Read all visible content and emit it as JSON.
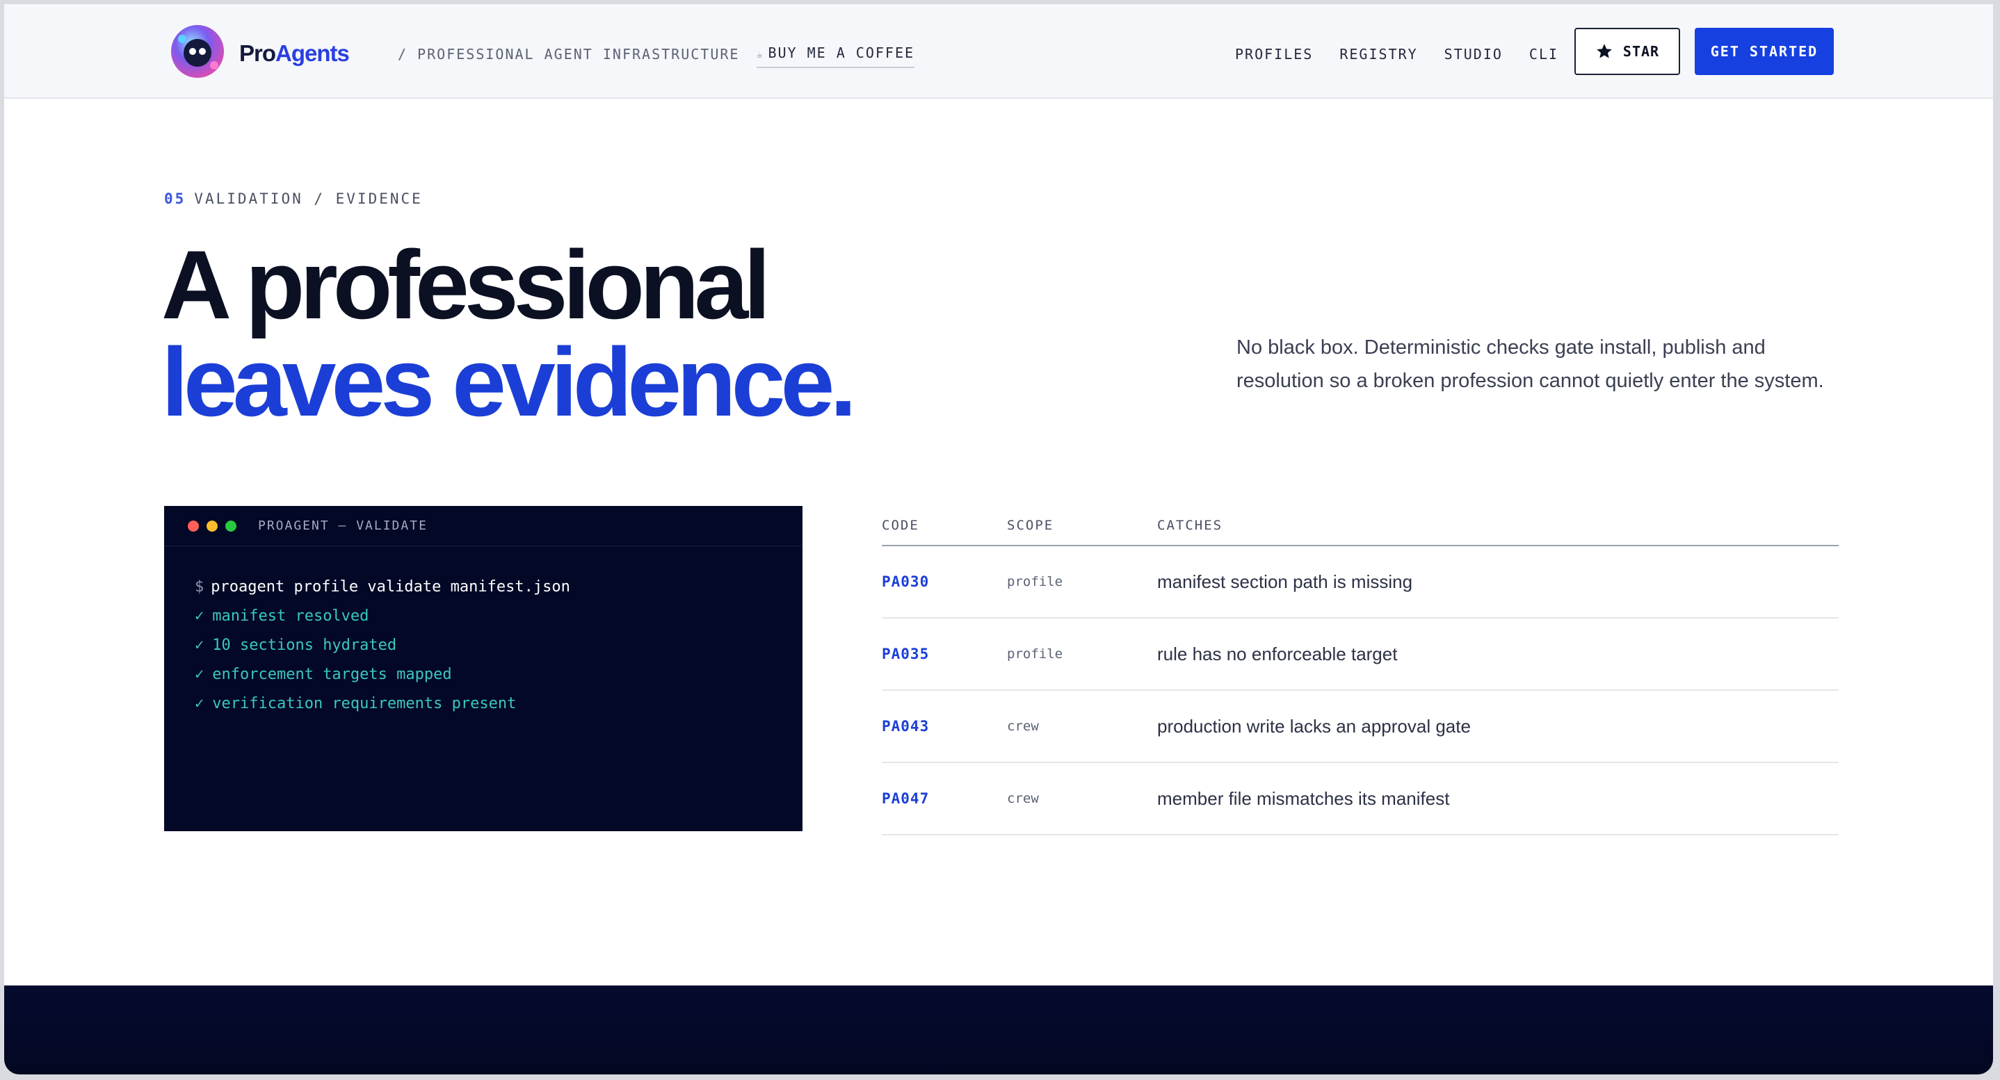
{
  "nav": {
    "brand_pre": "Pro",
    "brand_accent": "Agents",
    "tagline": "/ PROFESSIONAL AGENT INFRASTRUCTURE",
    "coffee_label": "BUY ME A COFFEE",
    "links": [
      "PROFILES",
      "REGISTRY",
      "STUDIO",
      "CLI"
    ],
    "star_label": "STAR",
    "cta_label": "GET STARTED"
  },
  "hero": {
    "eyebrow_num": "05",
    "eyebrow_text": "VALIDATION / EVIDENCE",
    "headline_line1": "A professional",
    "headline_line2": "leaves evidence.",
    "lede": "No black box. Deterministic checks gate install, publish and resolution so a broken profession cannot quietly enter the system."
  },
  "terminal": {
    "title": "PROAGENT — VALIDATE",
    "prompt": "$",
    "command": "proagent profile validate manifest.json",
    "check_glyph": "✓",
    "results": [
      "manifest resolved",
      "10 sections hydrated",
      "enforcement targets mapped",
      "verification requirements present"
    ]
  },
  "table": {
    "headers": [
      "CODE",
      "SCOPE",
      "CATCHES"
    ],
    "rows": [
      {
        "code": "PA030",
        "scope": "profile",
        "catches": "manifest section path is missing"
      },
      {
        "code": "PA035",
        "scope": "profile",
        "catches": "rule has no enforceable target"
      },
      {
        "code": "PA043",
        "scope": "crew",
        "catches": "production write lacks an approval gate"
      },
      {
        "code": "PA047",
        "scope": "crew",
        "catches": "member file mismatches its manifest"
      }
    ]
  },
  "colors": {
    "accent": "#1b3fd6",
    "cta": "#1640e0",
    "terminal_bg": "#020826",
    "terminal_ok": "#3cc7c0",
    "dot_red": "#ff5f57",
    "dot_yellow": "#febc2e",
    "dot_green": "#28c840"
  },
  "icons": {
    "logo": "proagents-logo",
    "star": "star-icon",
    "coffee": "coffee-icon"
  }
}
